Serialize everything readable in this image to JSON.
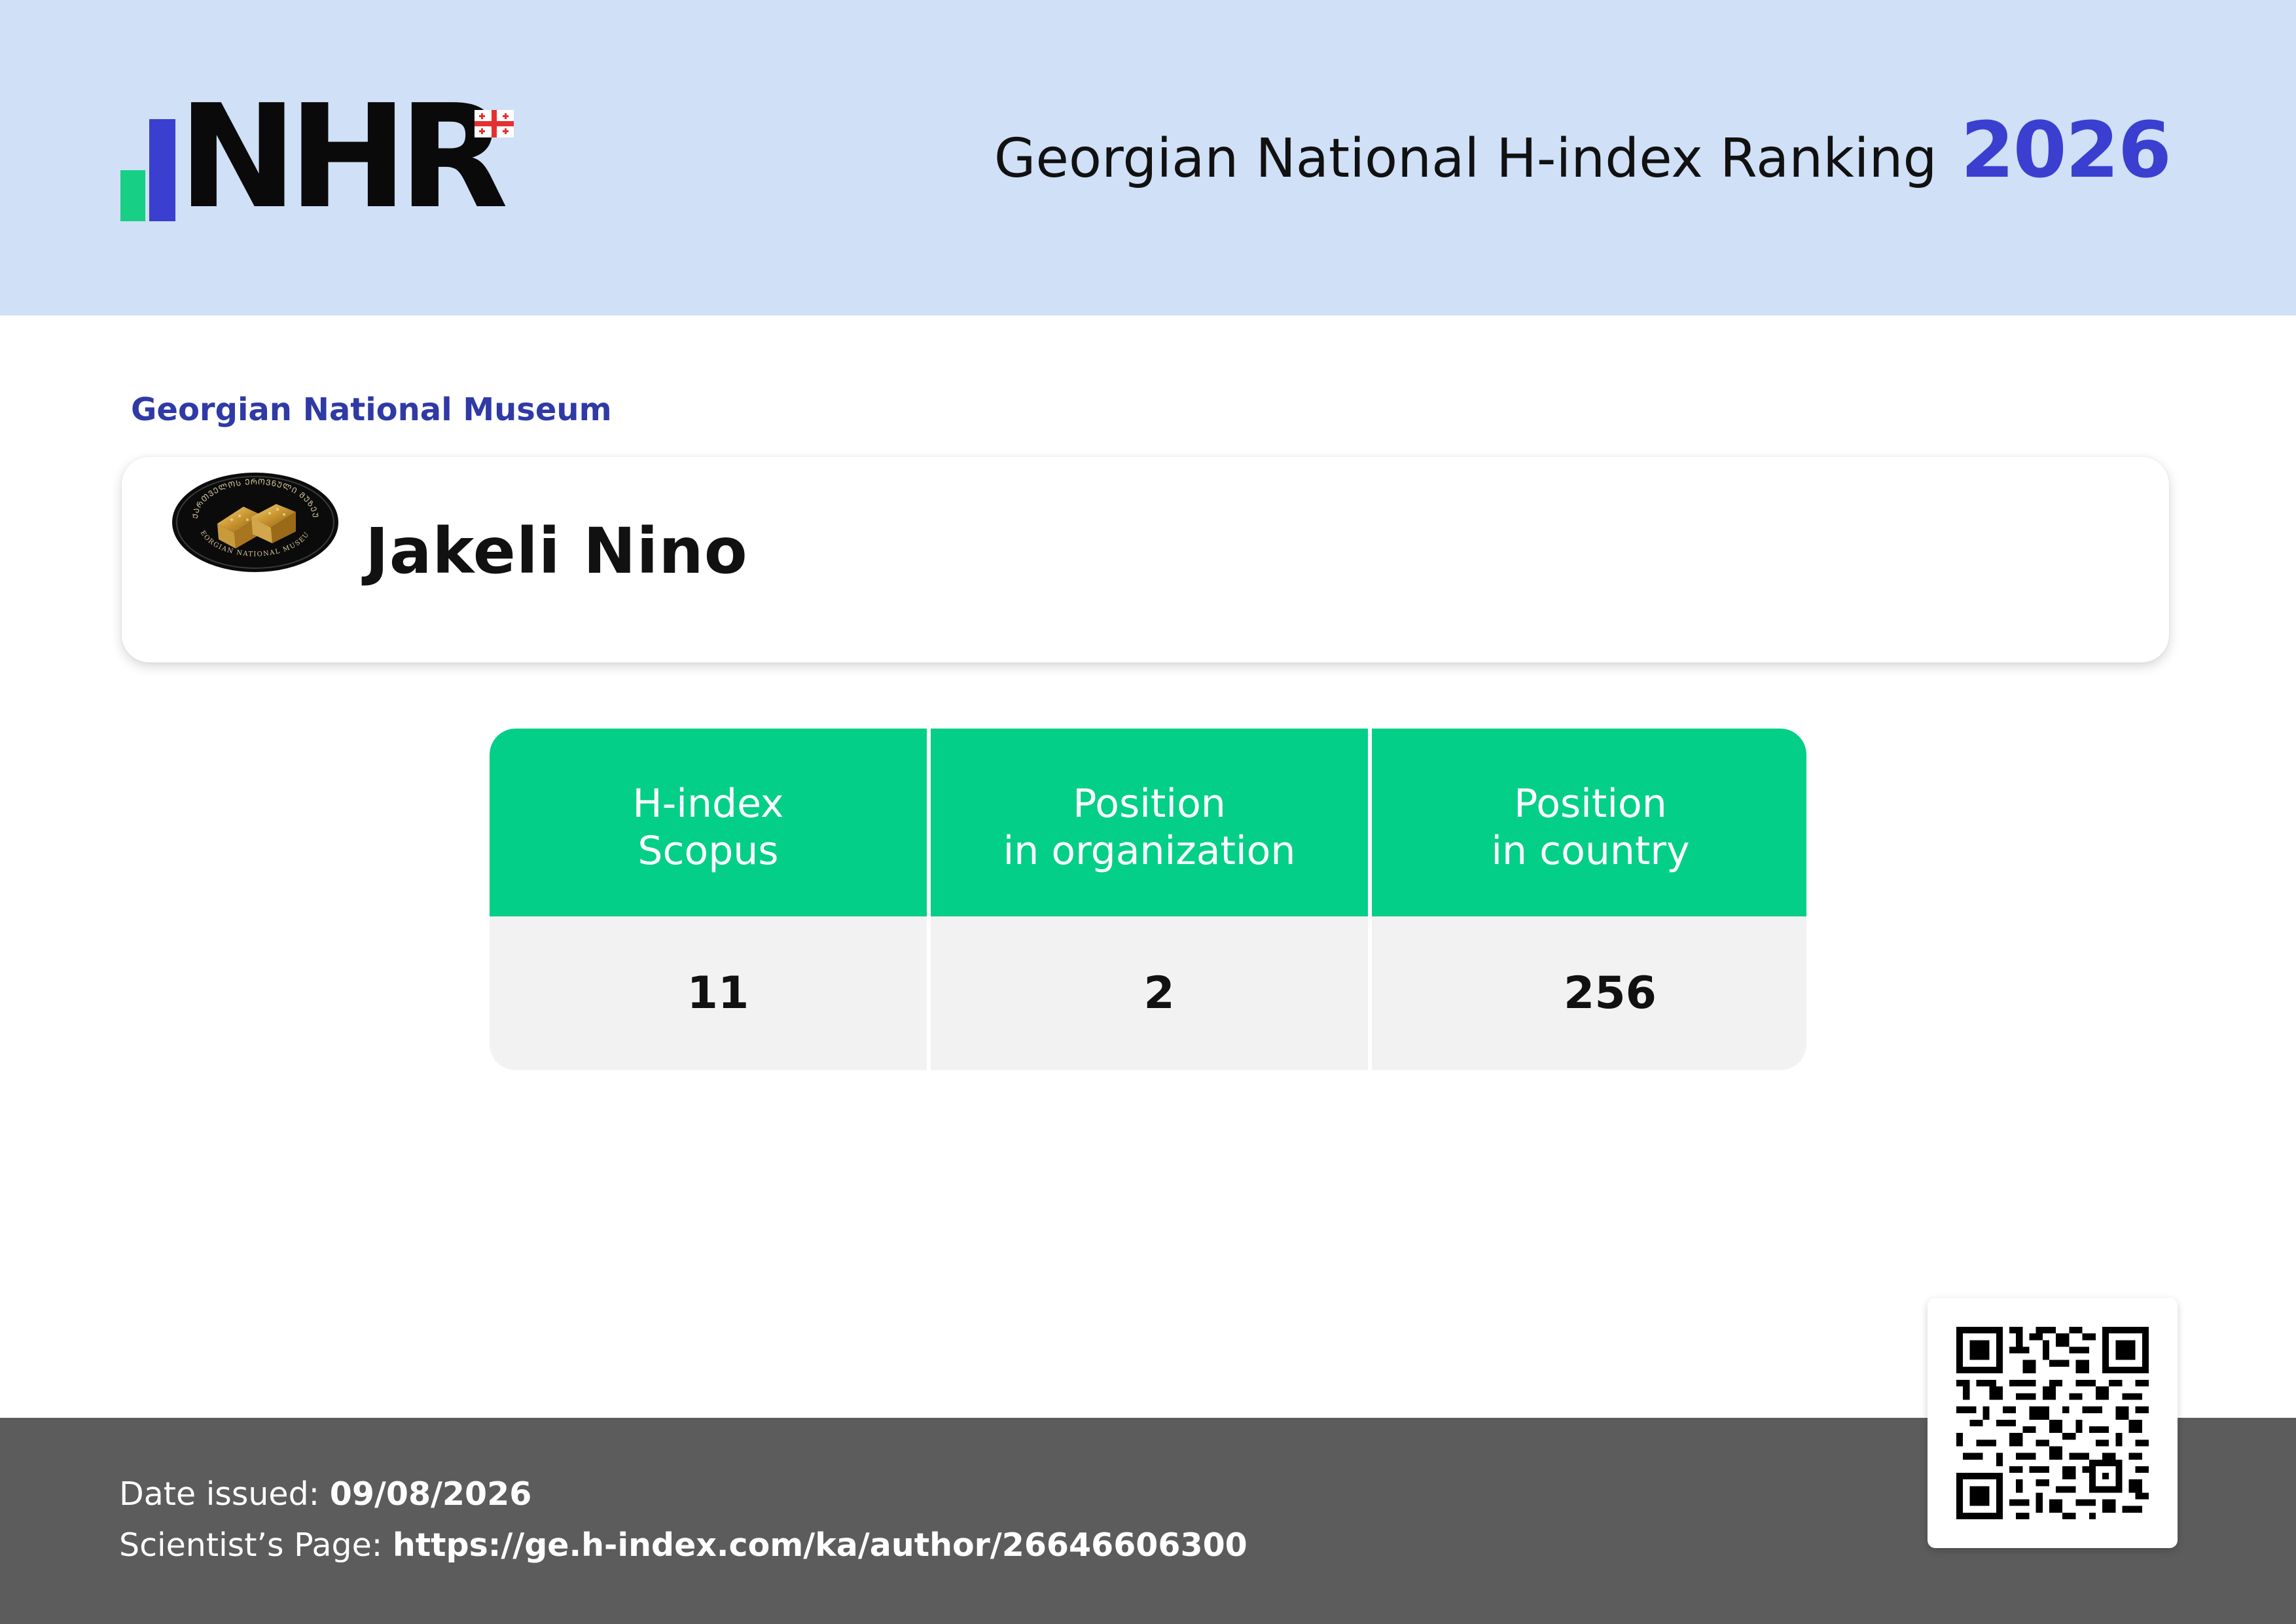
{
  "header": {
    "logo_text": "NHR",
    "title": "Georgian National H-index Ranking",
    "year": "2026"
  },
  "organization": {
    "name": "Georgian National Museum",
    "logo_inscription": "GEORGIAN NATIONAL MUSEUM"
  },
  "scientist": {
    "name": "Jakeli Nino"
  },
  "metrics": {
    "columns": [
      {
        "line1": "H-index",
        "line2": "Scopus",
        "value": "11"
      },
      {
        "line1": "Position",
        "line2": "in organization",
        "value": "2"
      },
      {
        "line1": "Position",
        "line2": "in country",
        "value": "256"
      }
    ]
  },
  "footer": {
    "date_label": "Date issued: ",
    "date_value": "09/08/2026",
    "page_label": "Scientist’s Page: ",
    "page_url": "https://ge.h-index.com/ka/author/26646606300"
  },
  "colors": {
    "header_bg": "#cfe0f7",
    "accent_blue": "#3a3fd0",
    "accent_green": "#04cf88",
    "footer_bg": "#5c5c5c"
  },
  "icons": {
    "flag": "georgia-flag-icon",
    "qr": "qr-code-icon"
  }
}
